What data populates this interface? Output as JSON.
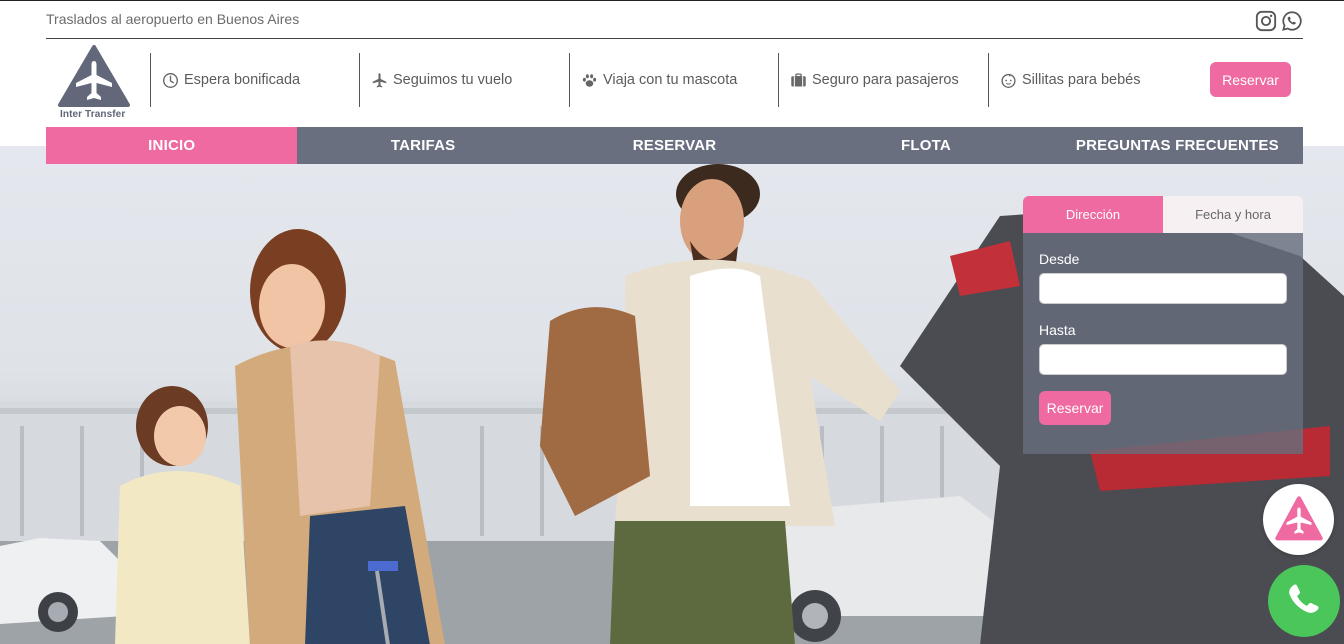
{
  "topbar": {
    "tagline": "Traslados al aeropuerto en Buenos Aires",
    "social": [
      {
        "icon": "instagram-icon"
      },
      {
        "icon": "whatsapp-icon"
      }
    ]
  },
  "header": {
    "brand_name": "Inter Transfer",
    "features": [
      {
        "icon": "clock-icon",
        "label": "Espera bonificada"
      },
      {
        "icon": "plane-icon",
        "label": "Seguimos tu vuelo"
      },
      {
        "icon": "paw-icon",
        "label": "Viaja con tu mascota"
      },
      {
        "icon": "suitcase-icon",
        "label": "Seguro para pasajeros"
      },
      {
        "icon": "baby-icon",
        "label": "Sillitas para bebés"
      }
    ],
    "cta_label": "Reservar"
  },
  "nav": {
    "items": [
      {
        "label": "INICIO",
        "active": true
      },
      {
        "label": "TARIFAS",
        "active": false
      },
      {
        "label": "RESERVAR",
        "active": false
      },
      {
        "label": "FLOTA",
        "active": false
      },
      {
        "label": "PREGUNTAS FRECUENTES",
        "active": false
      }
    ]
  },
  "booking": {
    "tabs": [
      {
        "label": "Dirección",
        "active": true
      },
      {
        "label": "Fecha y hora",
        "active": false
      }
    ],
    "from_label": "Desde",
    "from_value": "",
    "to_label": "Hasta",
    "to_value": "",
    "submit_label": "Reservar"
  },
  "colors": {
    "accent": "#ee6aa1",
    "nav_bg": "#6a6f80",
    "whatsapp": "#4bc65a"
  }
}
